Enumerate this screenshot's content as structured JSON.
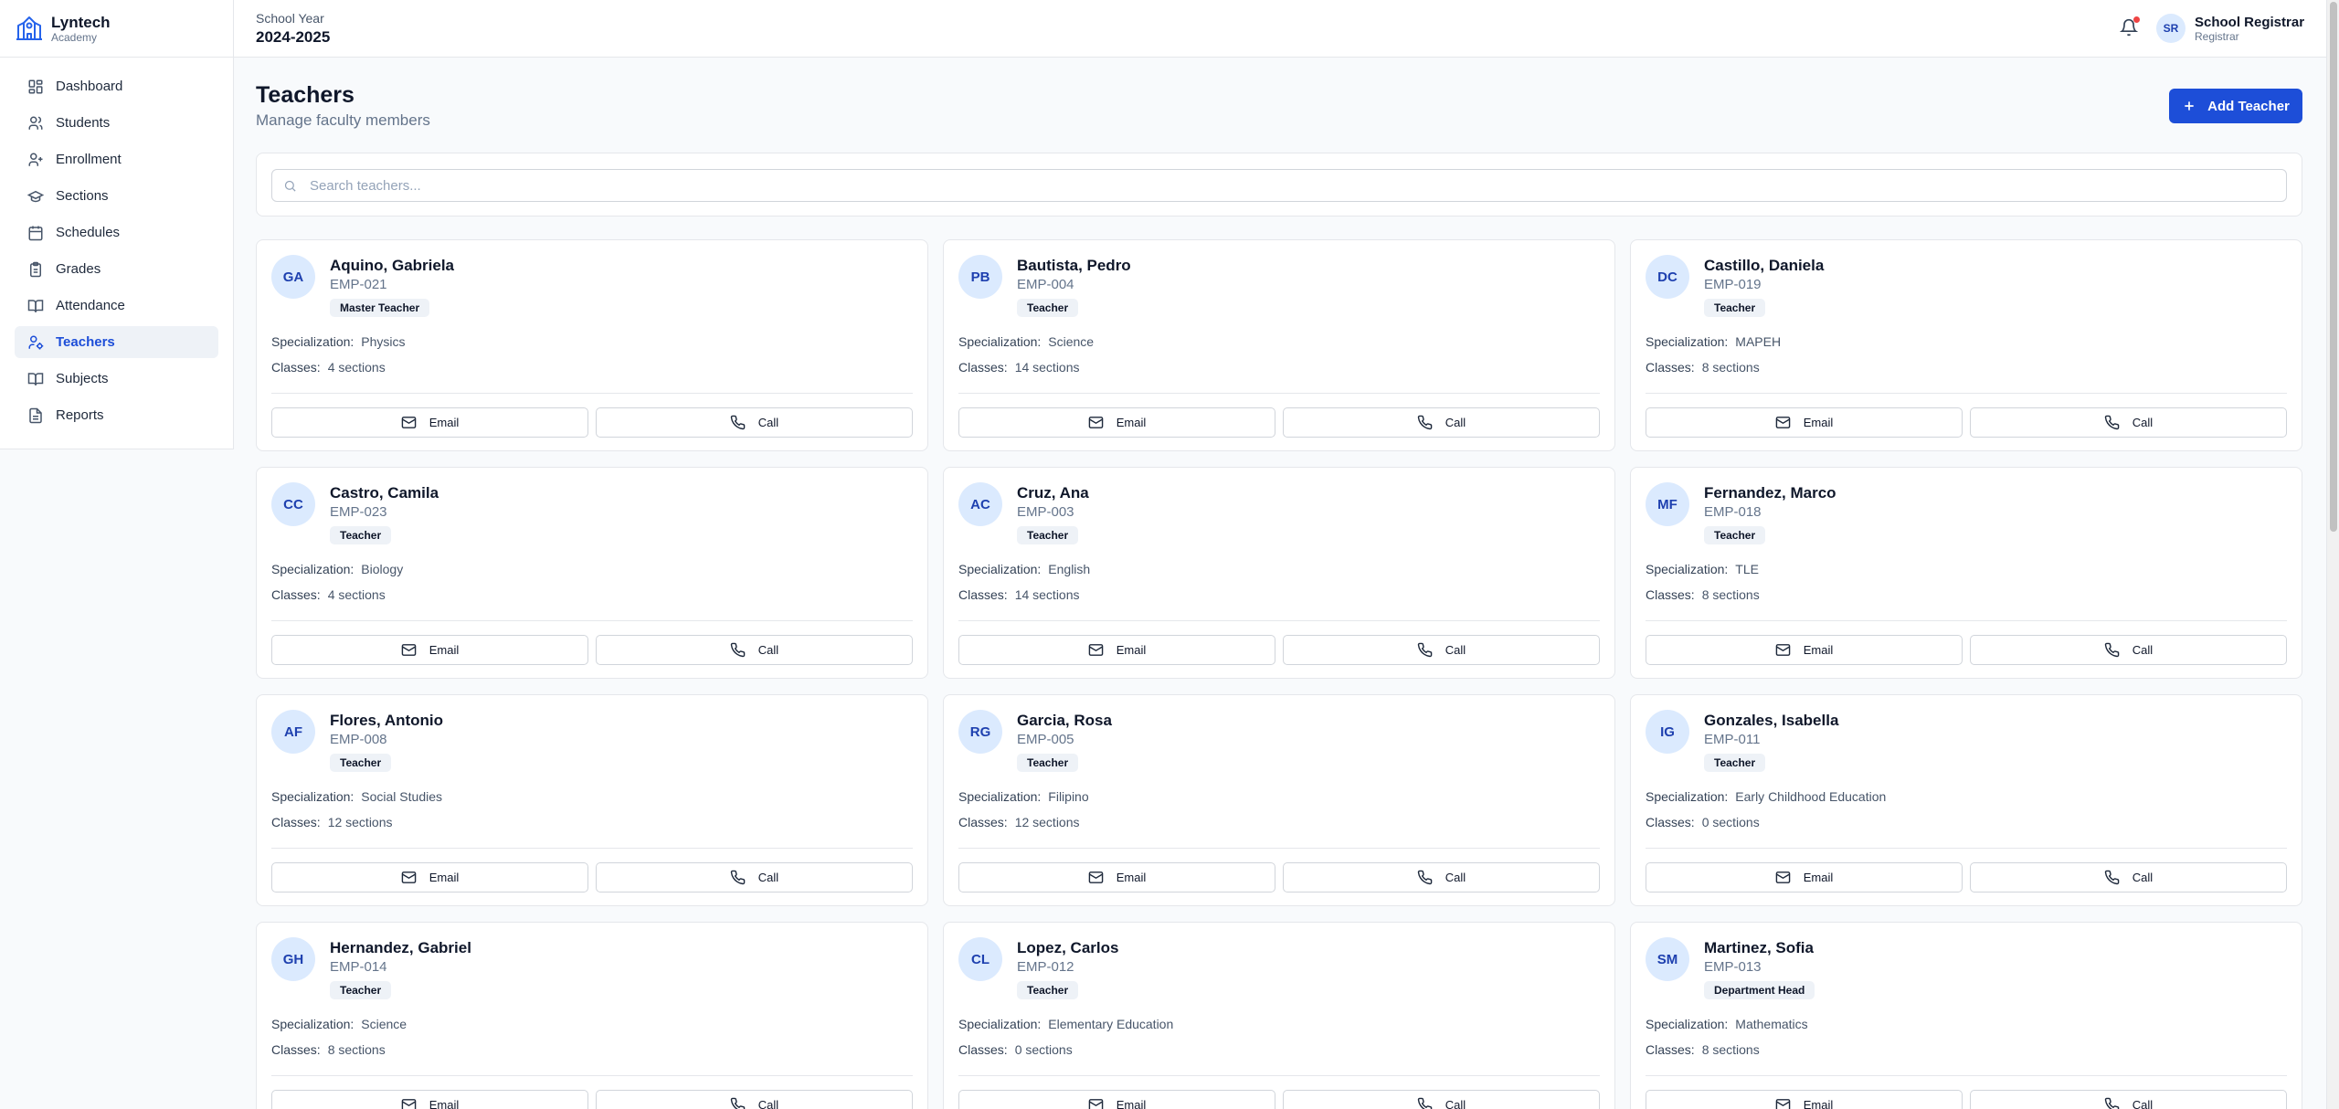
{
  "brand": {
    "name": "Lyntech",
    "sub": "Academy",
    "icon": "school-building-icon"
  },
  "nav": [
    {
      "label": "Dashboard",
      "icon": "dashboard-icon"
    },
    {
      "label": "Students",
      "icon": "users-icon"
    },
    {
      "label": "Enrollment",
      "icon": "user-plus-icon"
    },
    {
      "label": "Sections",
      "icon": "graduation-cap-icon"
    },
    {
      "label": "Schedules",
      "icon": "calendar-icon"
    },
    {
      "label": "Grades",
      "icon": "clipboard-icon"
    },
    {
      "label": "Attendance",
      "icon": "book-open-icon"
    },
    {
      "label": "Teachers",
      "icon": "user-cog-icon",
      "active": true
    },
    {
      "label": "Subjects",
      "icon": "book-icon"
    },
    {
      "label": "Reports",
      "icon": "file-text-icon"
    }
  ],
  "topbar": {
    "school_year_label": "School Year",
    "school_year_value": "2024-2025",
    "user": {
      "initials": "SR",
      "name": "School Registrar",
      "role": "Registrar"
    }
  },
  "page": {
    "title": "Teachers",
    "subtitle": "Manage faculty members",
    "add_button_label": "Add Teacher",
    "search_placeholder": "Search teachers..."
  },
  "labels": {
    "specialization": "Specialization:",
    "classes": "Classes:",
    "email": "Email",
    "call": "Call"
  },
  "colors": {
    "primary": "#1d4ed8",
    "avatar_bg": "#dbeafe",
    "notification_dot": "#ef4444"
  },
  "teachers": [
    {
      "initials": "GA",
      "name": "Aquino, Gabriela",
      "emp": "EMP-021",
      "role": "Master Teacher",
      "specialization": "Physics",
      "classes": "4 sections"
    },
    {
      "initials": "PB",
      "name": "Bautista, Pedro",
      "emp": "EMP-004",
      "role": "Teacher",
      "specialization": "Science",
      "classes": "14 sections"
    },
    {
      "initials": "DC",
      "name": "Castillo, Daniela",
      "emp": "EMP-019",
      "role": "Teacher",
      "specialization": "MAPEH",
      "classes": "8 sections"
    },
    {
      "initials": "CC",
      "name": "Castro, Camila",
      "emp": "EMP-023",
      "role": "Teacher",
      "specialization": "Biology",
      "classes": "4 sections"
    },
    {
      "initials": "AC",
      "name": "Cruz, Ana",
      "emp": "EMP-003",
      "role": "Teacher",
      "specialization": "English",
      "classes": "14 sections"
    },
    {
      "initials": "MF",
      "name": "Fernandez, Marco",
      "emp": "EMP-018",
      "role": "Teacher",
      "specialization": "TLE",
      "classes": "8 sections"
    },
    {
      "initials": "AF",
      "name": "Flores, Antonio",
      "emp": "EMP-008",
      "role": "Teacher",
      "specialization": "Social Studies",
      "classes": "12 sections"
    },
    {
      "initials": "RG",
      "name": "Garcia, Rosa",
      "emp": "EMP-005",
      "role": "Teacher",
      "specialization": "Filipino",
      "classes": "12 sections"
    },
    {
      "initials": "IG",
      "name": "Gonzales, Isabella",
      "emp": "EMP-011",
      "role": "Teacher",
      "specialization": "Early Childhood Education",
      "classes": "0 sections"
    },
    {
      "initials": "GH",
      "name": "Hernandez, Gabriel",
      "emp": "EMP-014",
      "role": "Teacher",
      "specialization": "Science",
      "classes": "8 sections"
    },
    {
      "initials": "CL",
      "name": "Lopez, Carlos",
      "emp": "EMP-012",
      "role": "Teacher",
      "specialization": "Elementary Education",
      "classes": "0 sections"
    },
    {
      "initials": "SM",
      "name": "Martinez, Sofia",
      "emp": "EMP-013",
      "role": "Department Head",
      "specialization": "Mathematics",
      "classes": "8 sections"
    }
  ]
}
